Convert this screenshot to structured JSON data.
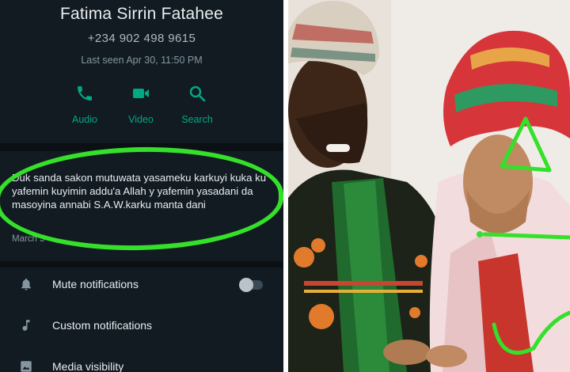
{
  "contact": {
    "name": "Fatima Sirrin Fatahee",
    "phone": "+234 902 498 9615",
    "last_seen": "Last seen Apr 30, 11:50 PM"
  },
  "actions": [
    {
      "label": "Audio",
      "icon": "phone-icon"
    },
    {
      "label": "Video",
      "icon": "video-camera-icon"
    },
    {
      "label": "Search",
      "icon": "search-icon"
    }
  ],
  "about": {
    "text": "Duk sanda sakon mutuwata yasameku karkuyi kuka ku yafemin kuyimin addu'a Allah y yafemin yasadani da masoyina annabi S.A.W.karku manta dani",
    "date": "March 5"
  },
  "settings": {
    "mute": {
      "label": "Mute notifications",
      "icon": "bell-icon",
      "toggle_on": false
    },
    "custom": {
      "label": "Custom notifications",
      "icon": "music-note-icon"
    },
    "media": {
      "label": "Media visibility",
      "icon": "image-icon"
    }
  },
  "colors": {
    "background": "#121b22",
    "accent": "#00a884",
    "highlight": "#35e02a",
    "text_primary": "#e9edef",
    "text_secondary": "#8696a0"
  }
}
